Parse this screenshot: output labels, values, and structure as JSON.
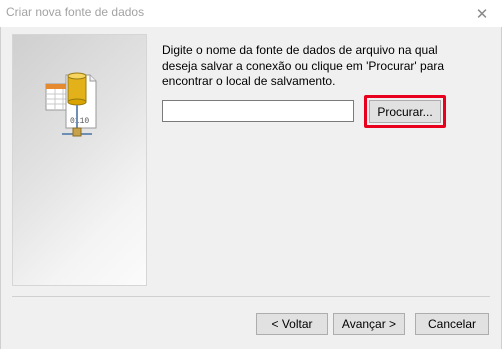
{
  "window": {
    "title": "Criar nova fonte de dados",
    "close_icon": "close-icon"
  },
  "main": {
    "description": "Digite o nome da fonte de dados de arquivo na qual deseja salvar a conexão ou clique em 'Procurar' para encontrar o local de salvamento.",
    "filename_input": {
      "value": "",
      "placeholder": ""
    },
    "browse_label": "Procurar...",
    "icon": "data-source-wizard-icon",
    "icon_text": "0110"
  },
  "footer": {
    "back_label": "< Voltar",
    "next_label": "Avançar >",
    "cancel_label": "Cancelar"
  },
  "colors": {
    "highlight": "#e8001c",
    "title_text": "#a3a3a3",
    "database_gold": "#d9a400"
  }
}
